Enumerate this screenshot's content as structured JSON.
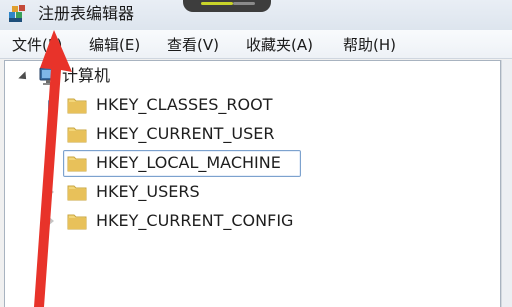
{
  "window": {
    "title": "注册表编辑器"
  },
  "menu": {
    "items": [
      {
        "label": "文件(F)"
      },
      {
        "label": "编辑(E)"
      },
      {
        "label": "查看(V)"
      },
      {
        "label": "收藏夹(A)"
      },
      {
        "label": "帮助(H)"
      }
    ]
  },
  "tree": {
    "root": {
      "label": "计算机",
      "icon": "computer-icon",
      "expanded": true
    },
    "keys": [
      {
        "label": "HKEY_CLASSES_ROOT",
        "icon": "folder-icon"
      },
      {
        "label": "HKEY_CURRENT_USER",
        "icon": "folder-icon"
      },
      {
        "label": "HKEY_LOCAL_MACHINE",
        "icon": "folder-icon",
        "selected": true
      },
      {
        "label": "HKEY_USERS",
        "icon": "folder-icon"
      },
      {
        "label": "HKEY_CURRENT_CONFIG",
        "icon": "folder-icon"
      }
    ]
  },
  "colors": {
    "annotation_arrow": "#e8332a",
    "selection_border": "#7da2ce",
    "folder": "#e8c15a"
  }
}
